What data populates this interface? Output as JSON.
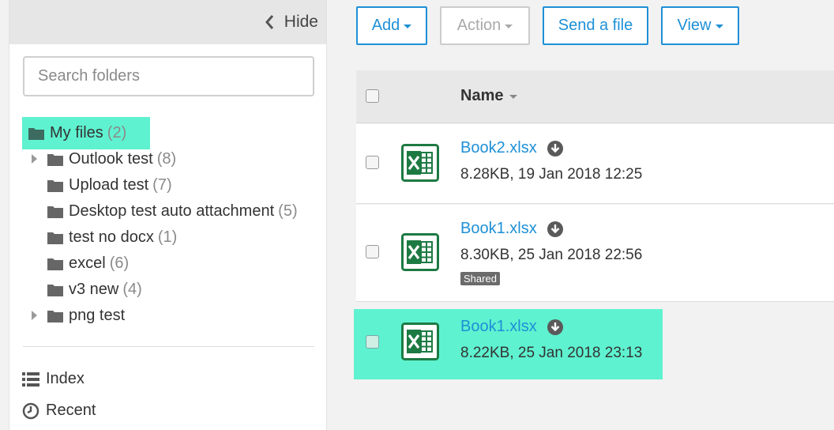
{
  "sidebar": {
    "hide_label": "Hide",
    "search_placeholder": "Search folders",
    "folders": [
      {
        "name": "My files",
        "count": "(2)",
        "selected": true
      },
      {
        "name": "Outlook test",
        "count": "(8)",
        "expandable": true
      },
      {
        "name": "Upload test",
        "count": "(7)"
      },
      {
        "name": "Desktop test auto attachment",
        "count": "(5)"
      },
      {
        "name": "test no docx",
        "count": "(1)"
      },
      {
        "name": "excel",
        "count": "(6)"
      },
      {
        "name": "v3 new",
        "count": "(4)"
      },
      {
        "name": "png test",
        "count": "",
        "expandable": true
      }
    ],
    "nav": [
      {
        "label": "Index",
        "icon": "list-icon"
      },
      {
        "label": "Recent",
        "icon": "clock-icon"
      }
    ]
  },
  "toolbar": {
    "add_label": "Add",
    "action_label": "Action",
    "send_label": "Send a file",
    "view_label": "View"
  },
  "list": {
    "header_name": "Name",
    "files": [
      {
        "name": "Book2.xlsx",
        "meta": "8.28KB, 19 Jan 2018 12:25",
        "badge": ""
      },
      {
        "name": "Book1.xlsx",
        "meta": "8.30KB, 25 Jan 2018 22:56",
        "badge": "Shared"
      },
      {
        "name": "Book1.xlsx",
        "meta": "8.22KB, 25 Jan 2018 23:13",
        "badge": "",
        "highlighted": true
      }
    ]
  },
  "colors": {
    "accent": "#1e90d6",
    "highlight": "#5ef2d0",
    "excel_green": "#1d7a43"
  }
}
